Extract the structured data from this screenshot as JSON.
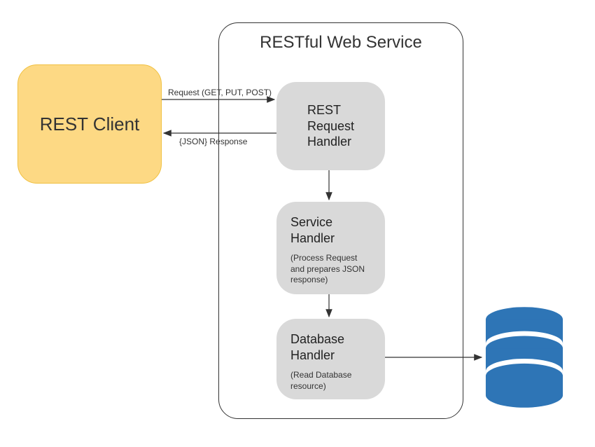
{
  "nodes": {
    "client": {
      "label": "REST Client"
    },
    "service_container": {
      "title": "RESTful Web Service"
    },
    "request_handler": {
      "title_line1": "REST",
      "title_line2": "Request",
      "title_line3": "Handler"
    },
    "service_handler": {
      "title_line1": "Service",
      "title_line2": "Handler",
      "subtitle": "(Process Request and prepares JSON response)"
    },
    "database_handler": {
      "title_line1": "Database",
      "title_line2": "Handler",
      "subtitle": "(Read Database resource)"
    }
  },
  "edges": {
    "request": "Request (GET, PUT, POST)",
    "response": "{JSON} Response"
  },
  "colors": {
    "client_bg": "#fdd984",
    "box_bg": "#d9d9d9",
    "arrow": "#333333",
    "db_fill": "#2e75b6"
  }
}
